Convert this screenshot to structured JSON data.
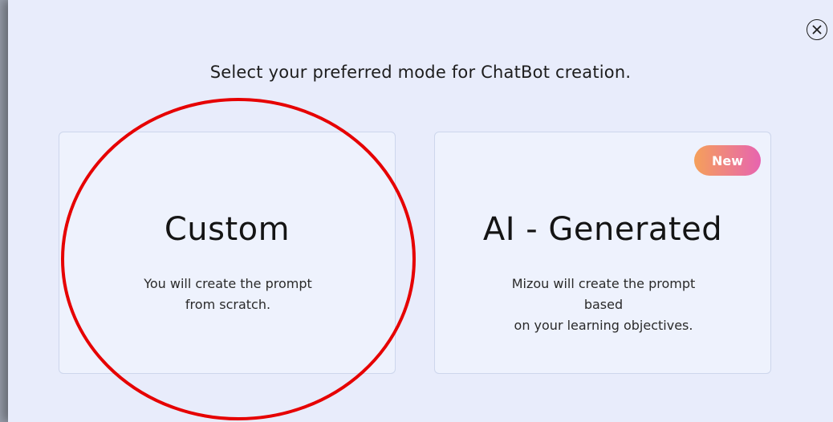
{
  "dialog": {
    "title": "Select your preferred mode for ChatBot creation.",
    "close_icon": "close-circle-icon"
  },
  "cards": [
    {
      "title": "Custom",
      "desc_line1": "You will create the prompt",
      "desc_line2": "from scratch."
    },
    {
      "title": "AI - Generated",
      "desc_line1": "Mizou will create the prompt based",
      "desc_line2": "on your learning objectives.",
      "badge": "New"
    }
  ],
  "colors": {
    "background": "#e8ecfb",
    "card": "#eef2fd",
    "annotation": "#e60000",
    "badge_gradient_start": "#f5a05a",
    "badge_gradient_end": "#e764b0"
  }
}
